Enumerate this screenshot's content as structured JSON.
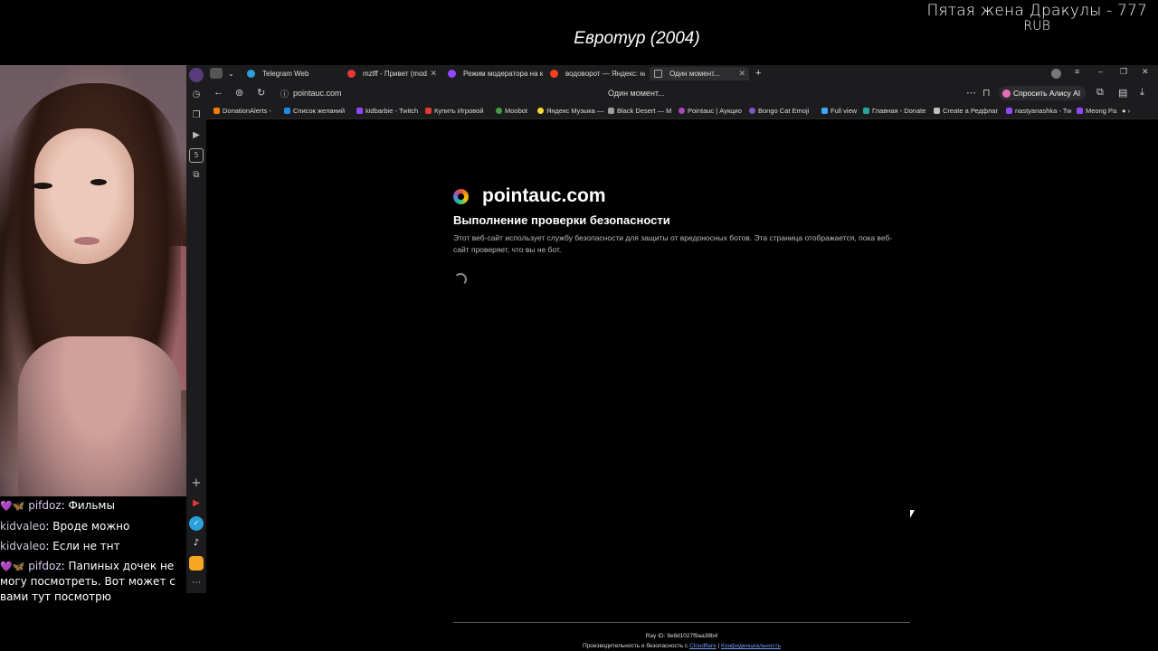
{
  "stream": {
    "title": "Евротур (2004)",
    "donation_goal": "Пятая жена Дракулы - 777",
    "donation_goal_currency": "RUB"
  },
  "chat": [
    {
      "badges": "💜🦋",
      "user": "pifdoz",
      "text": "Фильмы"
    },
    {
      "badges": "",
      "user": "kidvaleo",
      "text": "Вроде можно"
    },
    {
      "badges": "",
      "user": "kidvaleo",
      "text": "Если не тнт"
    },
    {
      "badges": "💜🦋",
      "user": "pifdoz",
      "text": "Папиных дочек не могу посмотреть. Вот может с вами тут посмотрю"
    }
  ],
  "browser": {
    "tabs": [
      {
        "label": "Telegram Web",
        "color": "#2aa1da"
      },
      {
        "label": "mzlff - Привет (mod",
        "color": "#e53935"
      },
      {
        "label": "Режим модератора на ка",
        "color": "#9146ff"
      },
      {
        "label": "водоворот — Яндекс: наш",
        "color": "#fc3f1d"
      },
      {
        "label": "Один момент...",
        "color": "#888888",
        "active": true
      }
    ],
    "new_tab": "+",
    "address": {
      "url": "pointauc.com",
      "page_title": "Один момент...",
      "ask_alice": "Спросить Алису AI"
    },
    "bookmarks": [
      {
        "label": "DonationAlerts -",
        "color": "#f57c00"
      },
      {
        "label": "Список желаний",
        "color": "#1e88e5"
      },
      {
        "label": "kidbarbie - Twitch",
        "color": "#9146ff"
      },
      {
        "label": "Купить Игровой",
        "color": "#e53935"
      },
      {
        "label": "Moobot",
        "color": "#43a047"
      },
      {
        "label": "Яндекс Музыка —",
        "color": "#fdd835"
      },
      {
        "label": "Black Desert — M",
        "color": "#9e9e9e"
      },
      {
        "label": "Pointauc | Аукцио",
        "color": "#ab47bc"
      },
      {
        "label": "Bongo Cat Emoji",
        "color": "#7e57c2"
      },
      {
        "label": "Full view",
        "color": "#42a5f5"
      },
      {
        "label": "Главная - Donate",
        "color": "#26a69a"
      },
      {
        "label": "Create a Редфлаг",
        "color": "#bdbdbd"
      },
      {
        "label": "nastyanashka - Tw",
        "color": "#9146ff"
      },
      {
        "label": "Meong Pa",
        "color": "#9146ff"
      }
    ],
    "page": {
      "site_name": "pointauc.com",
      "check_title": "Выполнение проверки безопасности",
      "check_desc": "Этот веб-сайт использует службу безопасности для защиты от вредоносных ботов. Эта страница отображается, пока веб-сайт проверяет, что вы не бот.",
      "ray_id": "Ray ID: 9e8d1027f9aa38b4",
      "perf_prefix": "Производительность и безопасность с",
      "cloudflare_link": "Cloudflare",
      "separator": "|",
      "privacy_link": "Конфиденциальность"
    }
  }
}
